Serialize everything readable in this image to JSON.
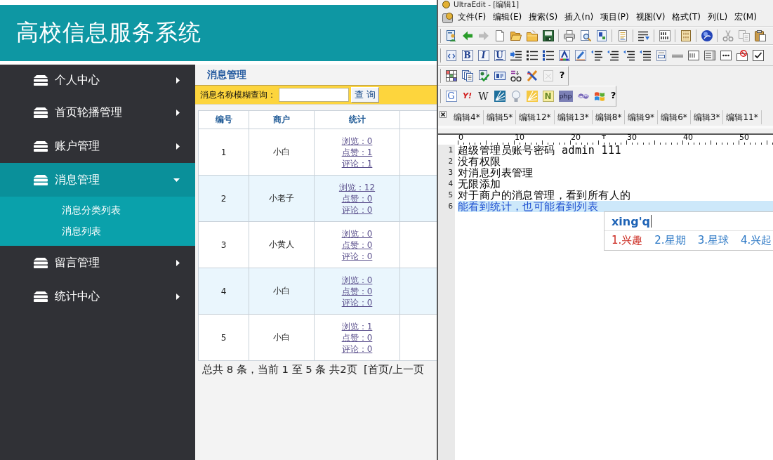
{
  "browser_page": {
    "title": "高校信息服务系统",
    "sidebar": {
      "items": [
        {
          "label": "个人中心",
          "selected": false,
          "expanded": false
        },
        {
          "label": "首页轮播管理",
          "selected": false,
          "expanded": false
        },
        {
          "label": "账户管理",
          "selected": false,
          "expanded": false
        },
        {
          "label": "消息管理",
          "selected": true,
          "expanded": true,
          "children": [
            {
              "label": "消息分类列表",
              "selected": false
            },
            {
              "label": "消息列表",
              "selected": false
            }
          ]
        },
        {
          "label": "留言管理",
          "selected": false,
          "expanded": false
        },
        {
          "label": "统计中心",
          "selected": false,
          "expanded": false
        }
      ]
    },
    "main": {
      "heading": "消息管理",
      "search": {
        "label": "消息名称模糊查询：",
        "button": "查 询"
      },
      "table": {
        "columns": [
          "编号",
          "商户",
          "统计"
        ],
        "rows": [
          {
            "number": "1",
            "merchant": "小白",
            "stats": [
              "浏览：0",
              "点赞：1",
              "评论：1"
            ]
          },
          {
            "number": "2",
            "merchant": "小老子",
            "stats": [
              "浏览：12",
              "点赞：0",
              "评论：0"
            ]
          },
          {
            "number": "3",
            "merchant": "小黄人",
            "stats": [
              "浏览：0",
              "点赞：0",
              "评论：0"
            ]
          },
          {
            "number": "4",
            "merchant": "小白",
            "stats": [
              "浏览：0",
              "点赞：0",
              "评论：0"
            ]
          },
          {
            "number": "5",
            "merchant": "小白",
            "stats": [
              "浏览：1",
              "点赞：0",
              "评论：0"
            ]
          }
        ]
      },
      "pagination": "总共 8 条，当前 1 至 5 条 共2页  [首页/上一页"
    }
  },
  "editor_window": {
    "title": "UltraEdit - [编辑1]",
    "menu": [
      "文件(F)",
      "编辑(E)",
      "搜索(S)",
      "插入(n)",
      "项目(P)",
      "视图(V)",
      "格式(T)",
      "列(L)",
      "宏(M)"
    ],
    "toolbars": [
      {
        "kind": "standard"
      },
      {
        "kind": "format",
        "labels": [
          "B",
          "I",
          "U"
        ]
      },
      {
        "kind": "tools",
        "labels": [
          "?"
        ]
      },
      {
        "kind": "web",
        "labels": [
          "G",
          "Y!",
          "W",
          "N",
          "php",
          "?"
        ]
      }
    ],
    "tabs": [
      {
        "label": "编辑4*",
        "selected": false
      },
      {
        "label": "编辑5*",
        "selected": false
      },
      {
        "label": "编辑12*",
        "selected": false
      },
      {
        "label": "编辑13*",
        "selected": false
      },
      {
        "label": "编辑8*",
        "selected": false
      },
      {
        "label": "编辑9*",
        "selected": false
      },
      {
        "label": "编辑6*",
        "selected": false
      },
      {
        "label": "编辑3*",
        "selected": false
      },
      {
        "label": "编辑11*",
        "selected": false
      }
    ],
    "ruler": [
      "0",
      "10",
      "20",
      "30",
      "40",
      "50"
    ],
    "lines": [
      {
        "number": "1",
        "text": "超级管理员账号密码 admin 111",
        "selected": false
      },
      {
        "number": "2",
        "text": "没有权限",
        "selected": false
      },
      {
        "number": "3",
        "text": "对消息列表管理",
        "selected": false
      },
      {
        "number": "4",
        "text": "无限添加",
        "selected": false
      },
      {
        "number": "5",
        "text": "对于商户的消息管理，看到所有人的",
        "selected": false
      },
      {
        "number": "6",
        "text": "能看到统计，也可能看到列表",
        "selected": true
      }
    ],
    "ime": {
      "input": "xing'q",
      "candidates": [
        {
          "label": "1.兴趣",
          "selected": true
        },
        {
          "label": "2.星期",
          "selected": false
        },
        {
          "label": "3.星球",
          "selected": false
        },
        {
          "label": "4.兴起",
          "selected": false
        }
      ]
    }
  }
}
